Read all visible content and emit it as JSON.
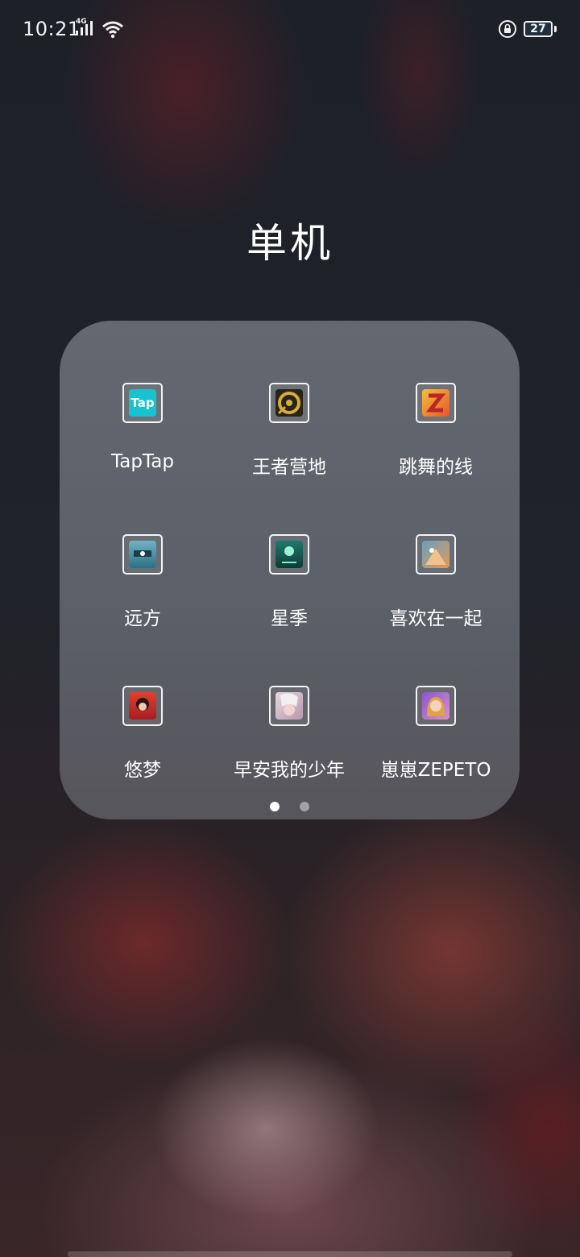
{
  "status_bar": {
    "time": "10:21",
    "network_type": "4G",
    "battery_level": "27",
    "icons": [
      "signal-icon",
      "wifi-icon",
      "rotation-lock-icon",
      "battery-icon"
    ]
  },
  "folder": {
    "title": "单机",
    "apps": [
      {
        "label": "TapTap",
        "icon": "taptap-icon",
        "icon_text": "Tap",
        "color": "#17c3ce"
      },
      {
        "label": "王者营地",
        "icon": "wangzhe-yingdi-icon",
        "color": "#c9a235"
      },
      {
        "label": "跳舞的线",
        "icon": "dancing-line-icon",
        "color": "#e6552b"
      },
      {
        "label": "远方",
        "icon": "yuanfang-icon",
        "color": "#3f8fa8"
      },
      {
        "label": "星季",
        "icon": "xingji-icon",
        "color": "#2fb394"
      },
      {
        "label": "喜欢在一起",
        "icon": "xihuan-zaiyiqi-icon",
        "color": "#e09a57"
      },
      {
        "label": "悠梦",
        "icon": "youmeng-icon",
        "color": "#d9302a"
      },
      {
        "label": "早安我的少年",
        "icon": "zaoan-shaonian-icon",
        "color": "#d9b9c8"
      },
      {
        "label": "崽崽ZEPETO",
        "icon": "zepeto-icon",
        "color": "#b07ac8"
      }
    ],
    "pages": {
      "count": 2,
      "current": 1
    }
  }
}
